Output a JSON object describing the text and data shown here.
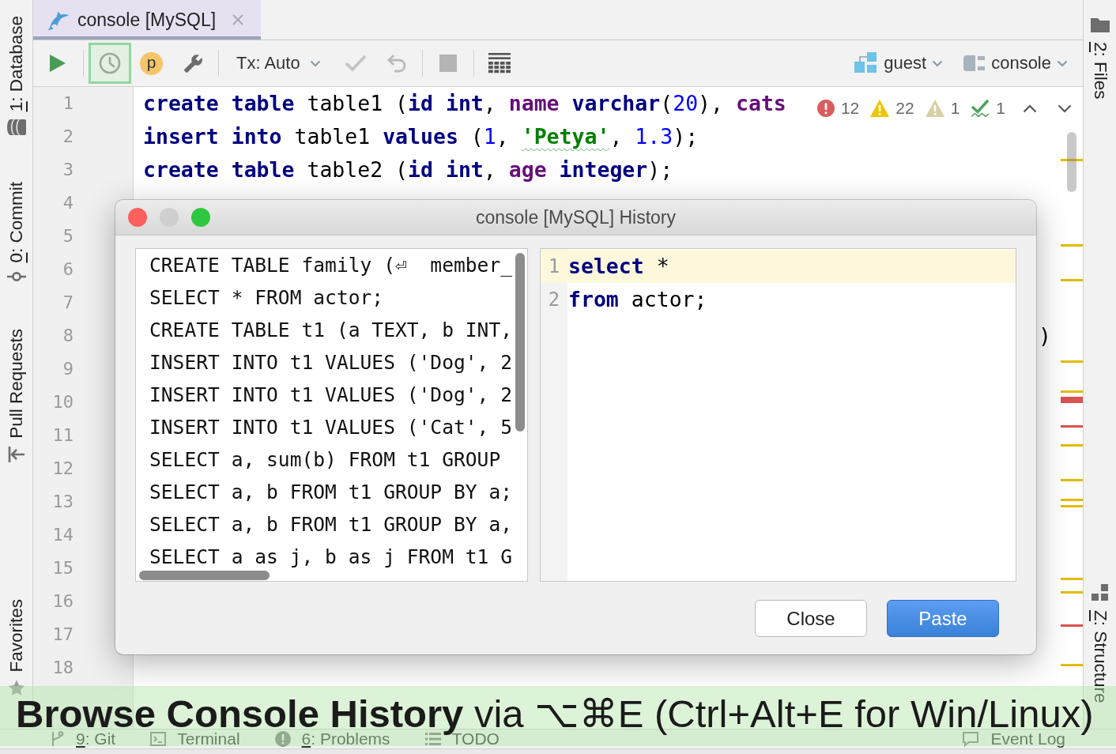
{
  "left_stripe": {
    "top": [
      {
        "label": "1: Database",
        "mnemonic": true
      },
      {
        "label": "0: Commit",
        "mnemonic": true
      },
      {
        "label": "Pull Requests",
        "mnemonic": false
      }
    ],
    "bottom": [
      {
        "label": "Favorites",
        "mnemonic": false
      }
    ]
  },
  "tabs": [
    {
      "label": "console [MySQL]",
      "selected": true
    }
  ],
  "toolbar": {
    "history": {
      "highlighted": true
    },
    "parameters": {
      "label": "p"
    },
    "transaction": {
      "label": "Tx: Auto"
    },
    "commit": {
      "disabled": true
    },
    "rollback": {
      "disabled": true
    },
    "stop": {
      "disabled": true
    },
    "schema": {
      "label": "guest"
    },
    "session": {
      "label": "console"
    }
  },
  "editor": {
    "lines": [
      {
        "number": "1",
        "tokens": [
          {
            "text": "create",
            "kind": "keyword"
          },
          {
            "text": " table",
            "kind": "keyword"
          },
          {
            "text": " table1 (",
            "kind": "plain"
          },
          {
            "text": "id",
            "kind": "keyword"
          },
          {
            "text": " int",
            "kind": "keyword"
          },
          {
            "text": ", ",
            "kind": "plain"
          },
          {
            "text": "name",
            "kind": "column"
          },
          {
            "text": " varchar",
            "kind": "keyword"
          },
          {
            "text": "(",
            "kind": "plain"
          },
          {
            "text": "20",
            "kind": "number"
          },
          {
            "text": "), ",
            "kind": "plain"
          },
          {
            "text": "cats",
            "kind": "column"
          }
        ]
      },
      {
        "number": "2",
        "tokens": [
          {
            "text": "insert",
            "kind": "keyword"
          },
          {
            "text": " into",
            "kind": "keyword"
          },
          {
            "text": " table1 ",
            "kind": "plain"
          },
          {
            "text": "values",
            "kind": "keyword"
          },
          {
            "text": " (",
            "kind": "plain"
          },
          {
            "text": "1",
            "kind": "number"
          },
          {
            "text": ", ",
            "kind": "plain"
          },
          {
            "text": "'Petya'",
            "kind": "string",
            "typo": true
          },
          {
            "text": ", ",
            "kind": "plain"
          },
          {
            "text": "1.3",
            "kind": "number"
          },
          {
            "text": ");",
            "kind": "plain"
          }
        ]
      },
      {
        "number": "3",
        "tokens": [
          {
            "text": "create",
            "kind": "keyword"
          },
          {
            "text": " table",
            "kind": "keyword"
          },
          {
            "text": " table2 (",
            "kind": "plain"
          },
          {
            "text": "id",
            "kind": "keyword"
          },
          {
            "text": " int",
            "kind": "keyword"
          },
          {
            "text": ", ",
            "kind": "plain"
          },
          {
            "text": "age",
            "kind": "column"
          },
          {
            "text": " integer",
            "kind": "keyword"
          },
          {
            "text": ");",
            "kind": "plain"
          }
        ]
      },
      {
        "number": "4"
      },
      {
        "number": "5"
      },
      {
        "number": "6"
      },
      {
        "number": "7"
      },
      {
        "number": "8",
        "tail": [
          {
            "text": ")",
            "kind": "plain"
          }
        ]
      },
      {
        "number": "9"
      },
      {
        "number": "10"
      },
      {
        "number": "11"
      },
      {
        "number": "12"
      },
      {
        "number": "13"
      },
      {
        "number": "14"
      },
      {
        "number": "15"
      },
      {
        "number": "16"
      },
      {
        "number": "17"
      },
      {
        "number": "18"
      }
    ],
    "inspections": [
      {
        "kind": "error",
        "count": "12"
      },
      {
        "kind": "warning",
        "count": "22"
      },
      {
        "kind": "weak_warning",
        "count": "1"
      },
      {
        "kind": "typo",
        "count": "1"
      }
    ],
    "stripe_marks": [
      {
        "color": "#e3bc00"
      },
      {
        "color": "#e3bc00"
      },
      {
        "color": "#e3bc00"
      },
      {
        "color": "#e3bc00"
      },
      {
        "color": "#e3bc00"
      },
      {
        "color": "#d9534f"
      },
      {
        "color": "#d9534f"
      },
      {
        "color": "#e3bc00"
      },
      {
        "color": "#e3bc00"
      },
      {
        "color": "#e3bc00"
      },
      {
        "color": "#e3bc00"
      },
      {
        "color": "#e3bc00"
      },
      {
        "color": "#e3bc00"
      },
      {
        "color": "#d9534f"
      },
      {
        "color": "#e3bc00"
      }
    ]
  },
  "right_stripe": {
    "top": [
      {
        "label": "2: Files",
        "mnemonic": true
      }
    ],
    "bottom": [
      {
        "label": "Z: Structure",
        "mnemonic": true
      }
    ]
  },
  "dialog": {
    "title": "console [MySQL] History",
    "window_buttons": [
      {
        "color": "#fc605c"
      },
      {
        "color": "#cfcfcf"
      },
      {
        "color": "#2ec840"
      }
    ],
    "history": [
      "CREATE TABLE family (⏎  member_",
      "SELECT * FROM actor;",
      "CREATE TABLE t1 (a TEXT, b INT,",
      "INSERT INTO t1 VALUES ('Dog', 2",
      "INSERT INTO t1 VALUES ('Dog', 2",
      "INSERT INTO t1 VALUES ('Cat', 5",
      "SELECT a, sum(b) FROM t1 GROUP",
      "SELECT a, b FROM t1 GROUP BY a;",
      "SELECT a, b FROM t1 GROUP BY a,",
      "SELECT a as j, b as j FROM t1 G"
    ],
    "preview": [
      {
        "number": "1",
        "tokens": [
          {
            "text": "select",
            "kind": "keyword"
          },
          {
            "text": " *",
            "kind": "plain"
          }
        ],
        "current": true
      },
      {
        "number": "2",
        "tokens": [
          {
            "text": "from",
            "kind": "keyword"
          },
          {
            "text": " actor;",
            "kind": "plain"
          }
        ],
        "current": false
      }
    ],
    "buttons": [
      {
        "label": "Close",
        "default": false
      },
      {
        "label": "Paste",
        "default": true
      }
    ]
  },
  "bottom_stripe": {
    "left": [
      {
        "label": "9: Git",
        "mnemonic": true
      },
      {
        "label": "Terminal",
        "mnemonic": false
      },
      {
        "label": "6: Problems",
        "mnemonic": true
      },
      {
        "label": "TODO",
        "mnemonic": false
      }
    ],
    "right": [
      {
        "label": "Event Log",
        "mnemonic": false
      }
    ]
  },
  "tip": {
    "text": "**Browse Console History** via ⌥⌘E (Ctrl+Alt+E for Win/Linux)"
  }
}
